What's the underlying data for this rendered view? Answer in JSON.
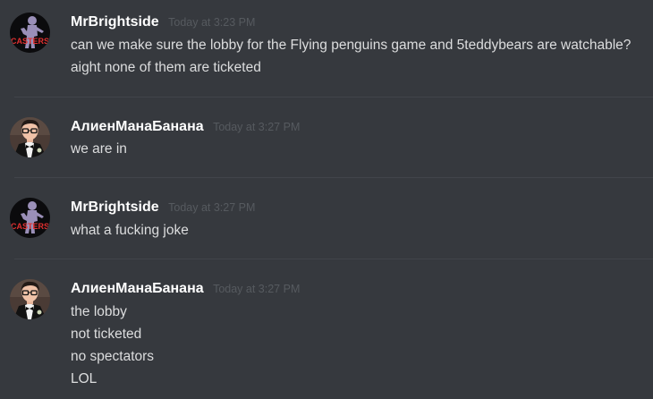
{
  "messages": [
    {
      "author": "MrBrightside",
      "avatar": "casters-avatar",
      "timestamp": "Today at 3:23 PM",
      "lines": [
        "can we make sure the lobby for the Flying penguins game and 5teddybears are watchable?",
        "aight none of them are ticketed"
      ]
    },
    {
      "author": "АлиенМанаБанана",
      "avatar": "man-in-tuxedo-avatar",
      "timestamp": "Today at 3:27 PM",
      "lines": [
        "we are in"
      ]
    },
    {
      "author": "MrBrightside",
      "avatar": "casters-avatar",
      "timestamp": "Today at 3:27 PM",
      "lines": [
        "what a fucking joke"
      ]
    },
    {
      "author": "АлиенМанаБанана",
      "avatar": "man-in-tuxedo-avatar",
      "timestamp": "Today at 3:27 PM",
      "lines": [
        "the lobby",
        "not ticketed",
        "no spectators",
        "LOL"
      ]
    }
  ],
  "avatar_text": {
    "casters": "CASTERS"
  },
  "colors": {
    "background": "#36393e",
    "username": "#ffffff",
    "timestamp": "#565a5f",
    "message_text": "#dcddde",
    "divider": "#41444a"
  }
}
